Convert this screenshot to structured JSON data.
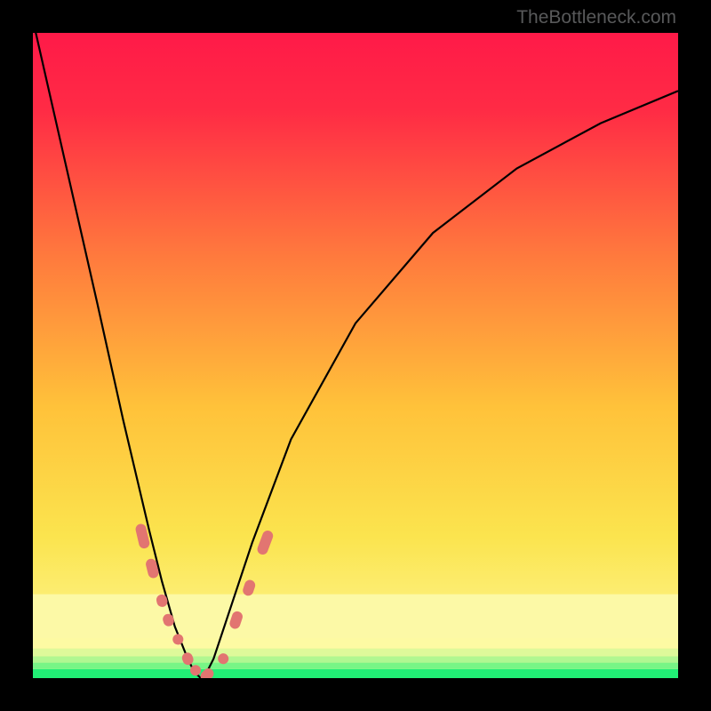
{
  "watermark": {
    "text": "TheBottleneck.com"
  },
  "chart_data": {
    "type": "line",
    "title": "",
    "xlabel": "",
    "ylabel": "",
    "xlim": [
      0,
      1
    ],
    "ylim": [
      0,
      1
    ],
    "series": [
      {
        "name": "bottleneck-curve",
        "x": [
          0.0,
          0.05,
          0.1,
          0.14,
          0.18,
          0.2,
          0.22,
          0.24,
          0.25,
          0.26,
          0.27,
          0.28,
          0.3,
          0.34,
          0.4,
          0.5,
          0.62,
          0.75,
          0.88,
          1.0
        ],
        "y": [
          1.02,
          0.8,
          0.58,
          0.4,
          0.23,
          0.15,
          0.08,
          0.03,
          0.01,
          0.0,
          0.01,
          0.03,
          0.09,
          0.21,
          0.37,
          0.55,
          0.69,
          0.79,
          0.86,
          0.91
        ]
      }
    ],
    "strips": [
      {
        "from": 0.0,
        "to": 0.014,
        "color": "#21ef75"
      },
      {
        "from": 0.014,
        "to": 0.024,
        "color": "#77f586"
      },
      {
        "from": 0.024,
        "to": 0.034,
        "color": "#b0f791"
      },
      {
        "from": 0.034,
        "to": 0.046,
        "color": "#def99a"
      },
      {
        "from": 0.046,
        "to": 0.062,
        "color": "#fdfaa3"
      },
      {
        "from": 0.062,
        "to": 0.13,
        "color": "#fcf9a6"
      }
    ],
    "gradient_top": "#ff1a48",
    "gradient_bottom": "#fdfaa3",
    "markers": [
      {
        "x": 0.17,
        "y": 0.22,
        "len": 28
      },
      {
        "x": 0.185,
        "y": 0.17,
        "len": 22
      },
      {
        "x": 0.2,
        "y": 0.12,
        "len": 14
      },
      {
        "x": 0.21,
        "y": 0.09,
        "len": 14
      },
      {
        "x": 0.225,
        "y": 0.06,
        "len": 12
      },
      {
        "x": 0.24,
        "y": 0.03,
        "len": 14
      },
      {
        "x": 0.252,
        "y": 0.012,
        "len": 12
      },
      {
        "x": 0.27,
        "y": 0.005,
        "len": 16
      },
      {
        "x": 0.295,
        "y": 0.03,
        "len": 12
      },
      {
        "x": 0.315,
        "y": 0.09,
        "len": 20
      },
      {
        "x": 0.335,
        "y": 0.14,
        "len": 18
      },
      {
        "x": 0.36,
        "y": 0.21,
        "len": 28
      }
    ],
    "marker_color": "#e27571"
  }
}
